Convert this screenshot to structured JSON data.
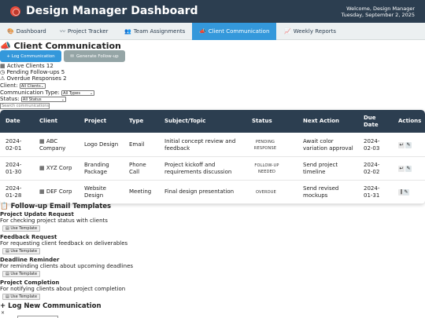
{
  "header": {
    "title": "Design Manager Dashboard",
    "welcome": "Welcome, Design Manager",
    "date": "Tuesday, September 2, 2025"
  },
  "tabs": [
    {
      "label": "Dashboard",
      "icon": "palette-icon",
      "glyph": "🎨"
    },
    {
      "label": "Project Tracker",
      "icon": "moustache-icon",
      "glyph": "〰"
    },
    {
      "label": "Team Assignments",
      "icon": "team-icon",
      "glyph": "👥"
    },
    {
      "label": "Client Communication",
      "icon": "megaphone-icon",
      "glyph": "📣"
    },
    {
      "label": "Weekly Reports",
      "icon": "chart-icon",
      "glyph": "📈"
    }
  ],
  "client_comm": {
    "title": "Client Communication",
    "log_button": "+ Log Communication",
    "followup_button": "Generate Follow-up",
    "stats": {
      "active": "Active Clients 12",
      "pending": "Pending Follow-ups 5",
      "overdue": "Overdue Responses 2"
    },
    "filters": {
      "client_label": "Client:",
      "client_value": "All Clients",
      "type_label": "Communication Type:",
      "type_value": "All Types",
      "status_label": "Status:",
      "status_value": "All Status",
      "search_placeholder": "Search communications..."
    }
  },
  "table": {
    "headers": [
      "Date",
      "Client",
      "Project",
      "Type",
      "Subject/Topic",
      "Status",
      "Next Action",
      "Due Date",
      "Actions"
    ],
    "rows": [
      {
        "date": "2024-02-01",
        "client": "ABC Company",
        "project": "Logo Design",
        "type": "Email",
        "subject": "Initial concept review and feedback",
        "status": "PENDING RESPONSE",
        "next": "Await color variation approval",
        "due": "2024-02-03"
      },
      {
        "date": "2024-01-30",
        "client": "XYZ Corp",
        "project": "Branding Package",
        "type": "Phone Call",
        "subject": "Project kickoff and requirements discussion",
        "status": "FOLLOW-UP NEEDED",
        "next": "Send project timeline",
        "due": "2024-02-02"
      },
      {
        "date": "2024-01-28",
        "client": "DEF Corp",
        "project": "Website Design",
        "type": "Meeting",
        "subject": "Final design presentation",
        "status": "OVERDUE",
        "next": "Send revised mockups",
        "due": "2024-01-31"
      }
    ]
  },
  "templates": {
    "title": "Follow-up Email Templates",
    "button_label": "Use Template",
    "items": [
      {
        "name": "Project Update Request",
        "desc": "For checking project status with clients"
      },
      {
        "name": "Feedback Request",
        "desc": "For requesting client feedback on deliverables"
      },
      {
        "name": "Deadline Reminder",
        "desc": "For reminding clients about upcoming deadlines"
      },
      {
        "name": "Project Completion",
        "desc": "For notifying clients about project completion"
      }
    ]
  },
  "log_form": {
    "title": "+ Log New Communication",
    "close": "×"
  }
}
